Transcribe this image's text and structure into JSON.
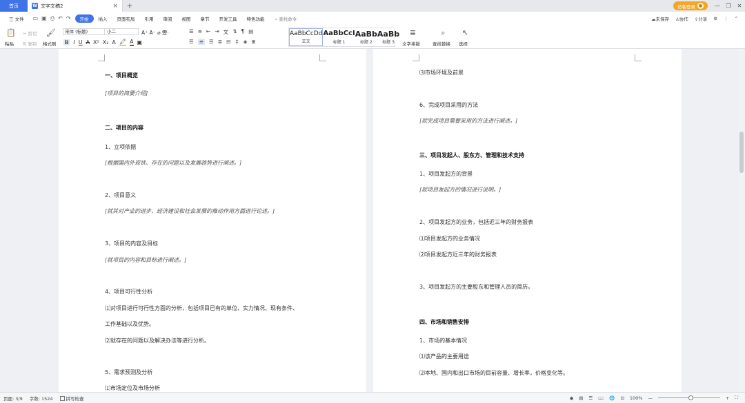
{
  "titlebar": {
    "home_tab": "首页",
    "doc_tab": "文字文稿2",
    "doc_icon": "W",
    "close_glyph": "×",
    "add_glyph": "+",
    "login": "访客登录",
    "win_min": "—",
    "win_restore": "❐",
    "win_close": "✕"
  },
  "menubar": {
    "file": "三 文件",
    "items": [
      "开始",
      "插入",
      "页面布局",
      "引用",
      "审阅",
      "视图",
      "章节",
      "开发工具",
      "特色功能"
    ],
    "search": "查找命令",
    "unsaved": "未保存",
    "collab": "协作",
    "share": "分享"
  },
  "ribbon": {
    "paste": "粘贴",
    "cut": "剪切",
    "copy": "复制",
    "format_painter": "格式刷",
    "font_name": "宋体 (标题)",
    "font_size": "小二",
    "styles": [
      {
        "preview": "AaBbCcDd",
        "label": "正文"
      },
      {
        "preview": "AaBbCcI",
        "label": "标题 1"
      },
      {
        "preview": "AaBb",
        "label": "标题 2"
      },
      {
        "preview": "AaBb",
        "label": "标题 3"
      }
    ],
    "text_layout": "文字排版",
    "find_replace": "查找替换",
    "select": "选择"
  },
  "page1": [
    {
      "t": "一、项目概览",
      "k": "h"
    },
    {
      "t": "[项目的简要介绍]",
      "k": "it"
    },
    {
      "t": "二、项目的内容",
      "k": "h"
    },
    {
      "t": "1、立项依据",
      "k": "n"
    },
    {
      "t": "[根据国内外现状、存在的问题以及发展趋势进行阐述。]",
      "k": "it"
    },
    {
      "t": "2、项目意义",
      "k": "n"
    },
    {
      "t": "[就其对产业的进步、经济建设和社会发展的推动作用方面进行论述。]",
      "k": "it"
    },
    {
      "t": "3、项目的内容及目标",
      "k": "n"
    },
    {
      "t": "[就项目的内容和目标进行阐述。]",
      "k": "it"
    },
    {
      "t": "4、项目可行性分析",
      "k": "n"
    },
    {
      "t": "⑴对项目进行可行性方面的分析，包括项目已有的单位、实力情况、现有条件、",
      "k": "n"
    },
    {
      "t": "工作基础以及优势。",
      "k": "n"
    },
    {
      "t": "⑵就存在的问题以及解决办法等进行分析。",
      "k": "n"
    },
    {
      "t": "5、需求预测及分析",
      "k": "n"
    },
    {
      "t": "⑴市场定位及市场分析",
      "k": "n"
    }
  ],
  "page2": [
    {
      "t": "⑶市场环境及前景",
      "k": "n"
    },
    {
      "t": "6、完成项目采用的方法",
      "k": "n"
    },
    {
      "t": "[就完成项目需要采用的方法进行阐述。]",
      "k": "it"
    },
    {
      "t": "三、项目发起人、股东方、管理和技术支持",
      "k": "h"
    },
    {
      "t": "1、项目发起方的背景",
      "k": "n"
    },
    {
      "t": "[就项目发起方的情况进行说明。]",
      "k": "it"
    },
    {
      "t": "2、项目发起方的业务，包括近三年的财务报表",
      "k": "n"
    },
    {
      "t": "⑴项目发起方的业务情况",
      "k": "n"
    },
    {
      "t": "⑵项目发起方近三年的财务报表",
      "k": "n"
    },
    {
      "t": "3、项目发起方的主要股东和管理人员的简历。",
      "k": "n"
    },
    {
      "t": "四、市场和销售安排",
      "k": "h"
    },
    {
      "t": "1、市场的基本情况",
      "k": "n"
    },
    {
      "t": "⑴该产品的主要用途",
      "k": "n"
    },
    {
      "t": "⑵本地、国内和出口市场的目前容量、增长率，价格变化等。",
      "k": "n"
    }
  ],
  "statusbar": {
    "page": "页面: 3/9",
    "words": "字数: 1524",
    "spell": "拼写检查",
    "zoom": "100%"
  },
  "colors": {
    "accent": "#3f74e8",
    "login": "#f5a623"
  }
}
